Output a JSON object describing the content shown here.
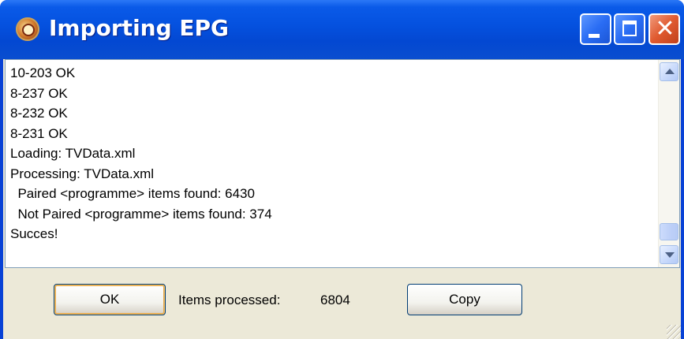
{
  "window": {
    "title": "Importing EPG",
    "controls": {
      "minimize": "minimize",
      "maximize": "maximize",
      "close": "close"
    }
  },
  "log": {
    "lines": [
      "10-203 OK",
      "8-237 OK",
      "8-232 OK",
      "8-231 OK",
      "Loading: TVData.xml",
      "Processing: TVData.xml",
      "  Paired <programme> items found: 6430",
      "  Not Paired <programme> items found: 374",
      "Succes!"
    ]
  },
  "footer": {
    "ok_label": "OK",
    "copy_label": "Copy",
    "status_label": "Items processed:",
    "status_value": "6804"
  },
  "icons": {
    "app": "app-icon",
    "minimize": "minimize-icon",
    "maximize": "maximize-icon",
    "close": "close-icon",
    "scroll_up": "chevron-up-icon",
    "scroll_down": "chevron-down-icon"
  },
  "colors": {
    "title_bar": "#0552e0",
    "close_button": "#e05a30",
    "dialog_body": "#ece9d8"
  }
}
